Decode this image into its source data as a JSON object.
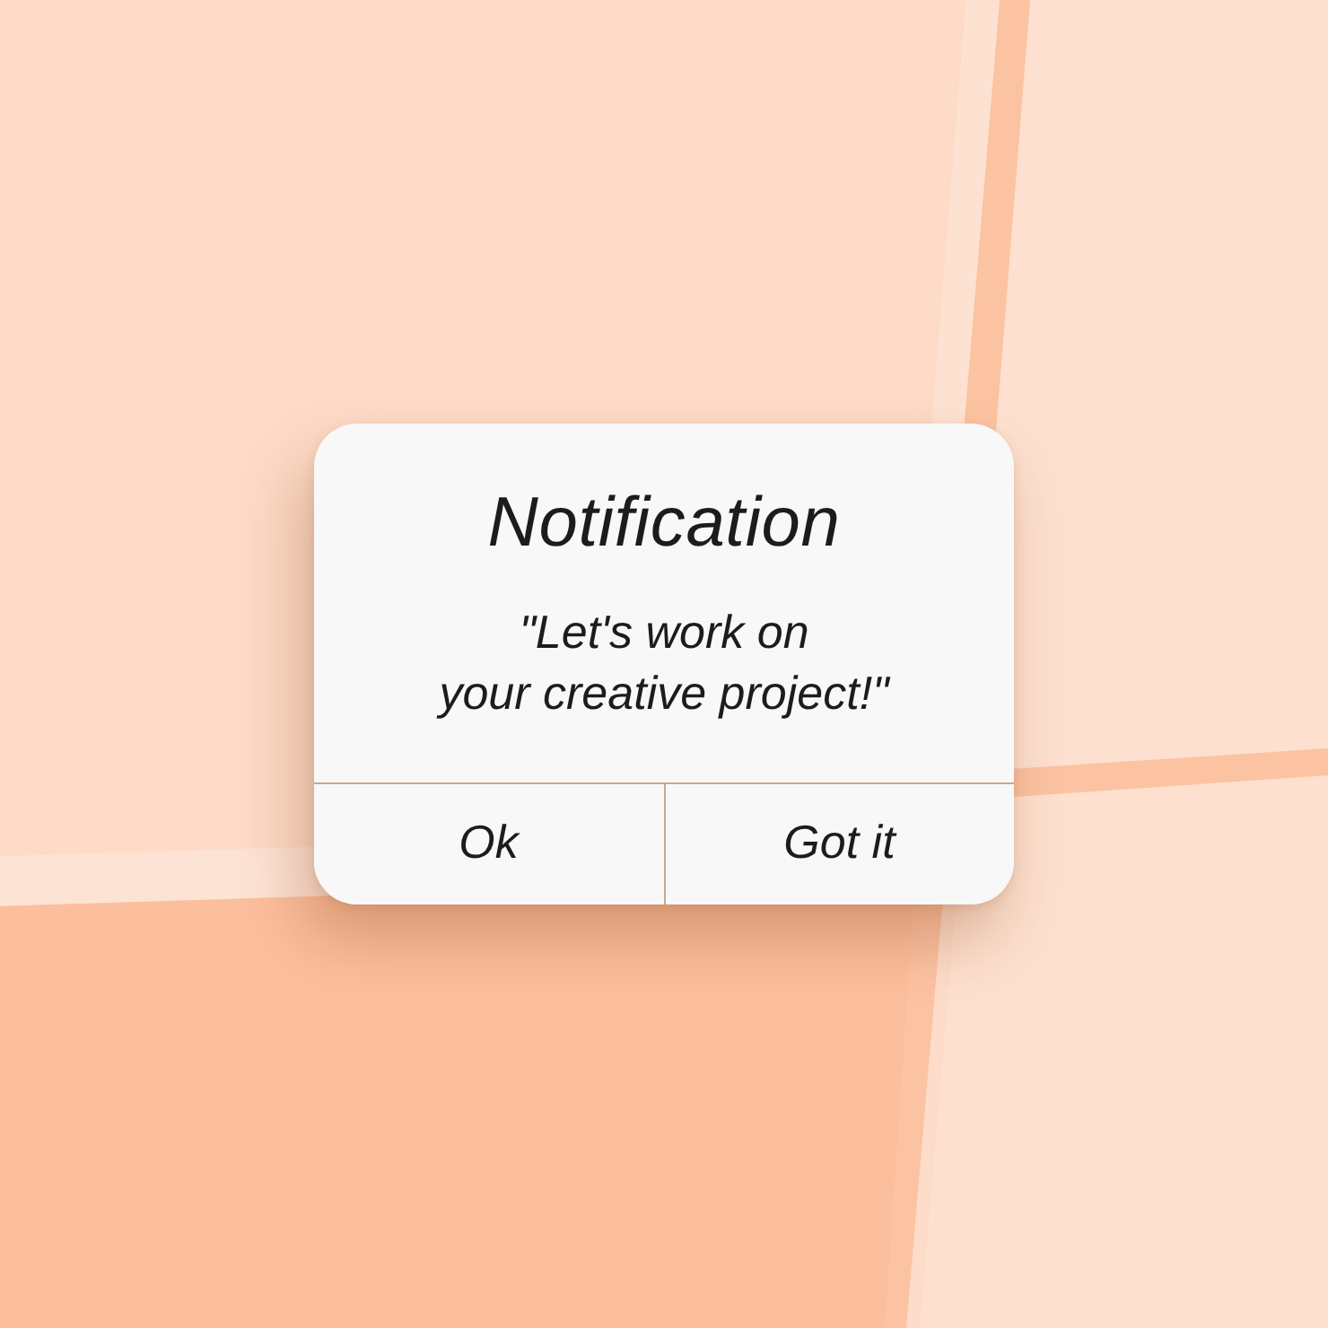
{
  "dialog": {
    "title": "Notification",
    "message": "\"Let's work on\nyour creative project!\"",
    "buttons": [
      {
        "label": "Ok"
      },
      {
        "label": "Got it"
      }
    ]
  }
}
